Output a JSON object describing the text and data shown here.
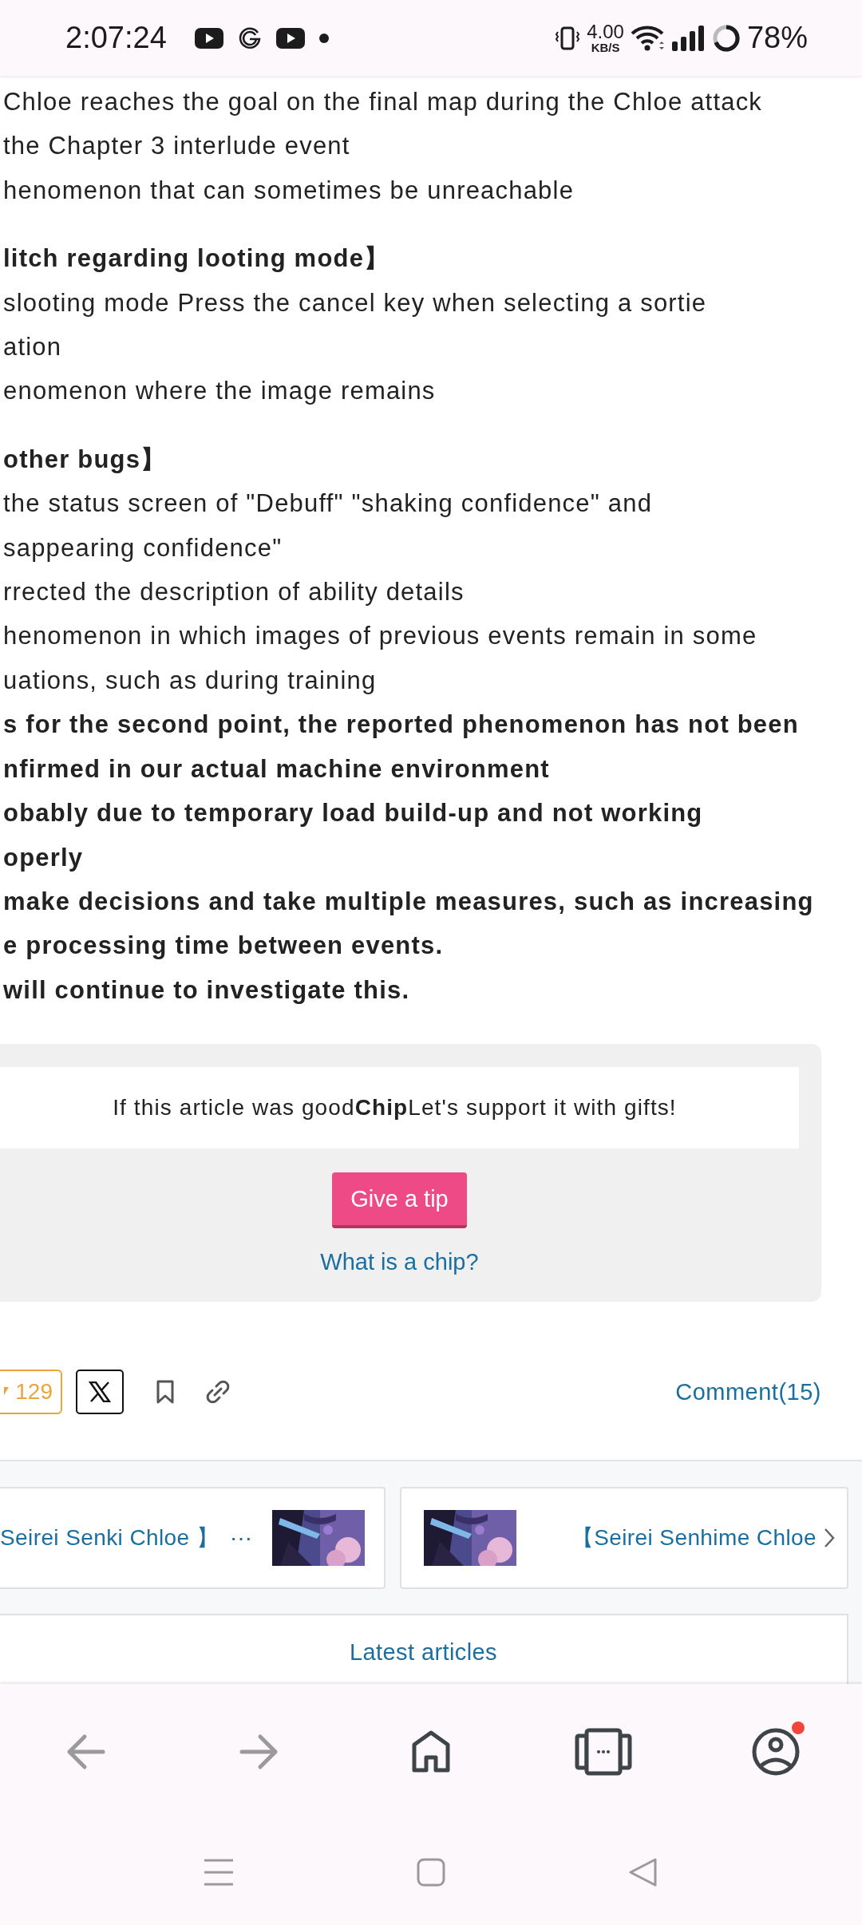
{
  "status_bar": {
    "time": "2:07:24",
    "speed_value": "4.00",
    "speed_unit": "KB/S",
    "battery": "78%"
  },
  "article": {
    "paragraphs": [
      {
        "lines": [
          {
            "text": "Chloe reaches the goal on the final map during the Chloe attack",
            "bold": false
          },
          {
            "text": "the Chapter 3 interlude event",
            "bold": false
          },
          {
            "text": "henomenon that can sometimes be unreachable",
            "bold": false
          }
        ]
      },
      {
        "lines": [
          {
            "text": "litch regarding looting mode】",
            "bold": true
          },
          {
            "text": "slooting mode Press the cancel key when selecting a sortie",
            "bold": false
          },
          {
            "text": "ation",
            "bold": false
          },
          {
            "text": "enomenon where the image remains",
            "bold": false
          }
        ]
      },
      {
        "lines": [
          {
            "text": "other bugs】",
            "bold": true
          },
          {
            "text": "the status screen of \"Debuff\" \"shaking confidence\" and",
            "bold": false
          },
          {
            "text": "sappearing confidence\"",
            "bold": false
          },
          {
            "text": "rrected the description of ability details",
            "bold": false
          },
          {
            "text": "henomenon in which images of previous events remain in some",
            "bold": false
          },
          {
            "text": "uations, such as during training",
            "bold": false
          },
          {
            "text": "s for the second point, the reported phenomenon has not been",
            "bold": true
          },
          {
            "text": "nfirmed in our actual machine environment",
            "bold": true
          },
          {
            "text": "obably due to temporary load build-up and not working",
            "bold": true
          },
          {
            "text": "operly",
            "bold": true
          },
          {
            "text": "make decisions and take multiple measures, such as increasing",
            "bold": true
          },
          {
            "text": "e processing time between events.",
            "bold": true
          },
          {
            "text": "will continue to investigate this.",
            "bold": true
          }
        ]
      }
    ]
  },
  "tip_box": {
    "message": "If this article was good**Chip**Let's support it with gifts!",
    "button": "Give a tip",
    "link": "What is a chip?"
  },
  "actions": {
    "likes": "129",
    "comments": "Comment(15)"
  },
  "related": [
    {
      "kind": "prev",
      "title": "Seirei Senki Chloe 】",
      "more": "⋯"
    },
    {
      "kind": "next",
      "title": "【Seirei Senhime Chloe"
    }
  ],
  "latest": {
    "title": "Latest articles"
  },
  "browser_nav": {
    "profile_notification": true
  }
}
